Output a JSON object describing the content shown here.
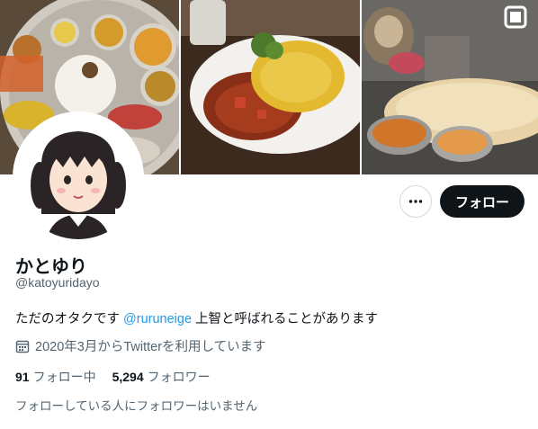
{
  "profile": {
    "name": "かとゆり",
    "handle": "@katoyuridayo",
    "bio_prefix": "ただのオタクです ",
    "bio_mention": "@ruruneige",
    "bio_suffix": " 上智と呼ばれることがあります",
    "joined": "2020年3月からTwitterを利用しています",
    "following_count": "91",
    "following_label": "フォロー中",
    "followers_count": "5,294",
    "followers_label": "フォロワー",
    "followers_you_know": "フォローしている人にフォロワーはいません"
  },
  "actions": {
    "follow_label": "フォロー",
    "more_icon": "more-horizontal-icon"
  },
  "banner": {
    "tiles": [
      "curry-thali-photo",
      "curry-rice-plate-photo",
      "dog-naan-curry-photo"
    ]
  },
  "colors": {
    "accent": "#1d9bf0",
    "text": "#0f1419",
    "muted": "#536471",
    "button_dark": "#0f1419"
  }
}
